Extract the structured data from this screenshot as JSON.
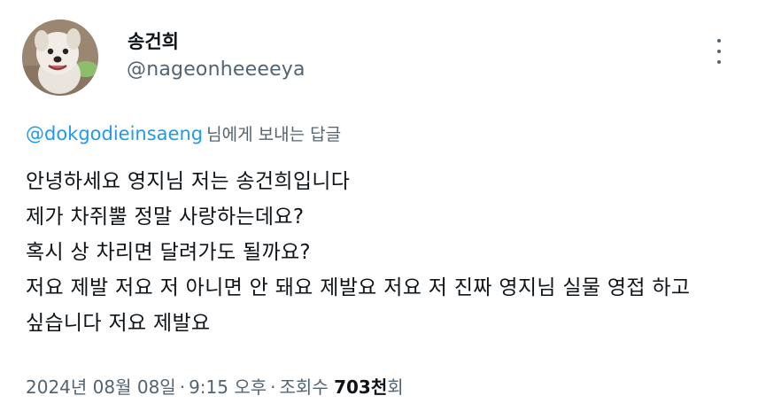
{
  "author": {
    "display_name": "송건희",
    "handle": "@nageonheeeeya"
  },
  "reply_context": {
    "mention": "@dokgodieinsaeng",
    "suffix": "님에게 보내는 답글"
  },
  "tweet": {
    "lines": [
      "안녕하세요 영지님 저는 송건희입니다",
      "제가 차쥐뿔 정말 사랑하는데요?",
      "혹시 상 차리면 달려가도 될까요?",
      "저요 제발 저요 저 아니면 안 돼요 제발요 저요 저 진짜 영지님 실물 영접 하고",
      "싶습니다 저요 제발요"
    ]
  },
  "meta": {
    "date": "2024년 08월 08일",
    "separator": "·",
    "time": "9:15 오후",
    "views_label": "조회수",
    "views_count": "703천",
    "views_unit": "회"
  },
  "icons": {
    "more": "more-horizontal-icon",
    "avatar": "dog-avatar-image"
  },
  "colors": {
    "link": "#1d9bf0",
    "secondary_text": "#536471",
    "primary_text": "#0f1419"
  }
}
